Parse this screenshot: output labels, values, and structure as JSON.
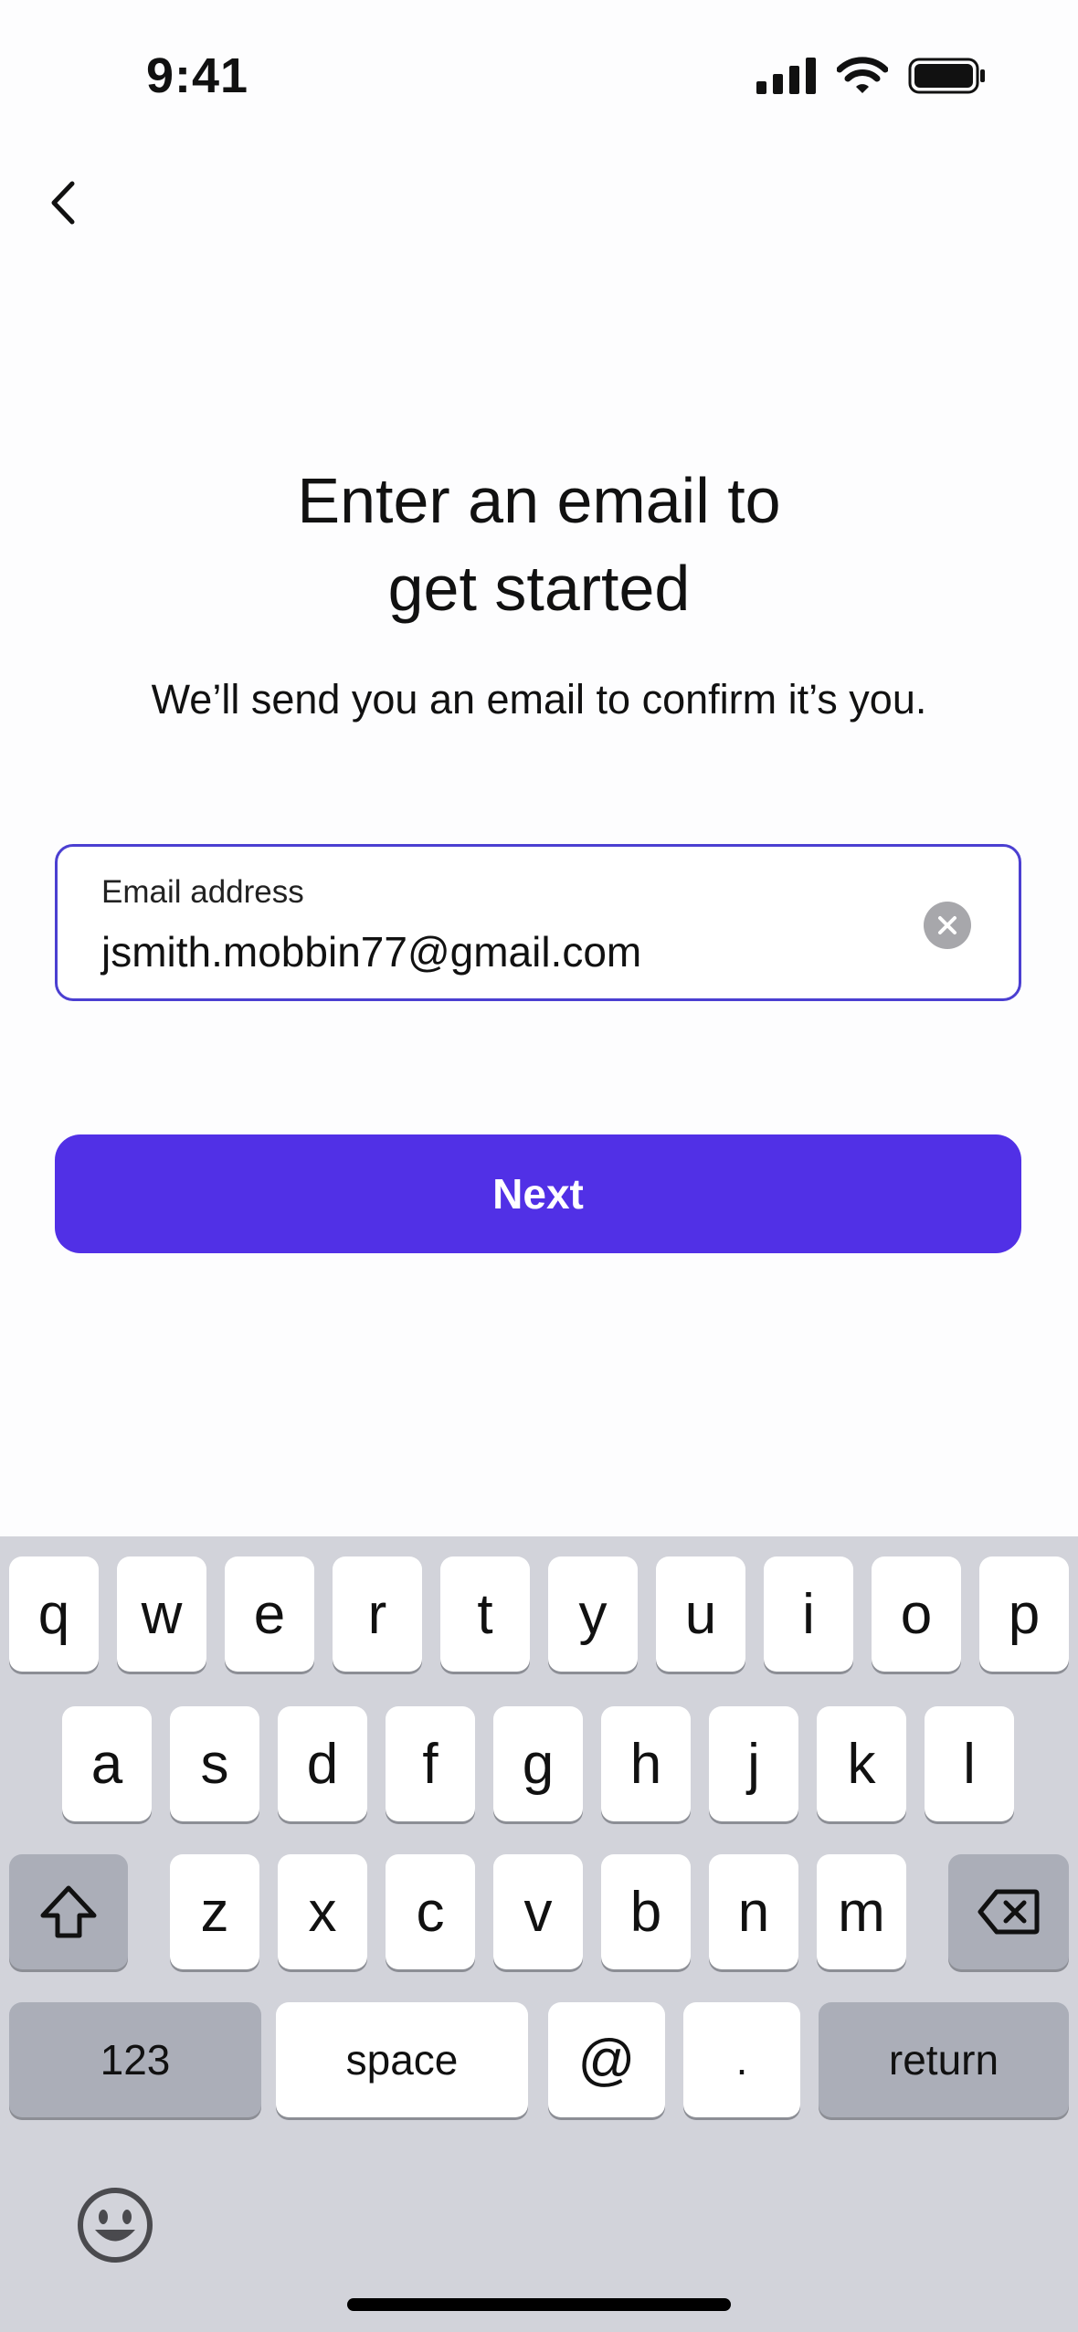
{
  "status_bar": {
    "time": "9:41"
  },
  "header": {
    "title_line1": "Enter an email to",
    "title_line2": "get started",
    "subtitle": "We’ll send you an email to confirm it’s you."
  },
  "email_field": {
    "label": "Email address",
    "value": "jsmith.mobbin77@gmail.com"
  },
  "next_button": {
    "label": "Next"
  },
  "keyboard": {
    "row1": [
      "q",
      "w",
      "e",
      "r",
      "t",
      "y",
      "u",
      "i",
      "o",
      "p"
    ],
    "row2": [
      "a",
      "s",
      "d",
      "f",
      "g",
      "h",
      "j",
      "k",
      "l"
    ],
    "row3": [
      "z",
      "x",
      "c",
      "v",
      "b",
      "n",
      "m"
    ],
    "numbers_label": "123",
    "space_label": "space",
    "at_label": "@",
    "period_label": ".",
    "return_label": "return"
  },
  "colors": {
    "accent": "#5130e6",
    "field_border": "#4b3fd1",
    "keyboard_bg": "#d2d3da"
  }
}
